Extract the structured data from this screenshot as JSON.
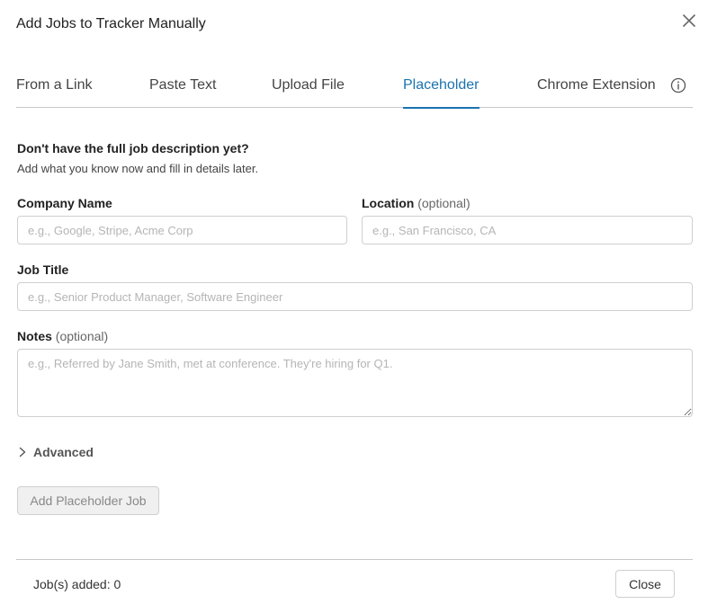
{
  "dialog": {
    "title": "Add Jobs to Tracker Manually",
    "close_icon": "close-icon"
  },
  "tabs": [
    {
      "label": "From a Link",
      "active": false
    },
    {
      "label": "Paste Text",
      "active": false
    },
    {
      "label": "Upload File",
      "active": false
    },
    {
      "label": "Placeholder",
      "active": true
    },
    {
      "label": "Chrome Extension",
      "active": false
    }
  ],
  "info_icon": "info-icon",
  "intro": {
    "question": "Don't have the full job description yet?",
    "subtitle": "Add what you know now and fill in details later."
  },
  "form": {
    "company": {
      "label": "Company Name",
      "value": "",
      "placeholder": "e.g., Google, Stripe, Acme Corp"
    },
    "location": {
      "label": "Location",
      "optional": "(optional)",
      "value": "",
      "placeholder": "e.g., San Francisco, CA"
    },
    "job_title": {
      "label": "Job Title",
      "value": "",
      "placeholder": "e.g., Senior Product Manager, Software Engineer"
    },
    "notes": {
      "label": "Notes",
      "optional": "(optional)",
      "value": "",
      "placeholder": "e.g., Referred by Jane Smith, met at conference. They're hiring for Q1."
    }
  },
  "advanced": {
    "label": "Advanced",
    "icon": "chevron-right-icon"
  },
  "add_button": {
    "label": "Add Placeholder Job",
    "disabled": true
  },
  "footer": {
    "jobs_added": "Job(s) added: 0",
    "close_label": "Close"
  },
  "colors": {
    "accent": "#1a73b0",
    "border": "#cfcfcf",
    "divider": "#c8c8c8"
  }
}
